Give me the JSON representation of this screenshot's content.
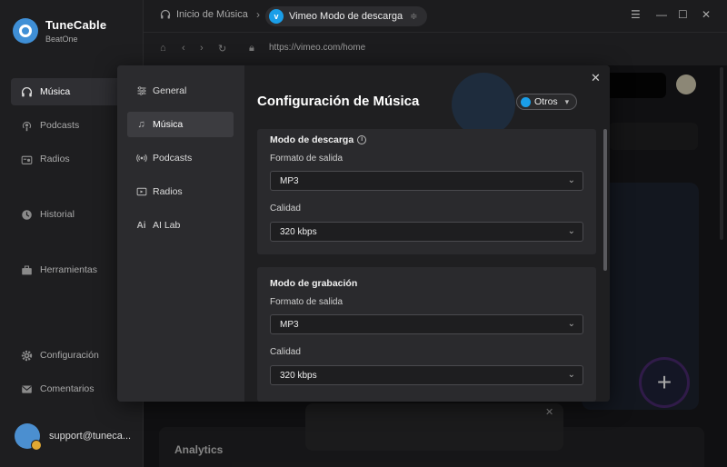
{
  "app": {
    "name": "TuneCable",
    "subtitle": "BeatOne"
  },
  "sidebar": {
    "items": [
      {
        "label": "Música",
        "icon": "headphones-icon",
        "active": true
      },
      {
        "label": "Podcasts",
        "icon": "podcast-icon"
      },
      {
        "label": "Radios",
        "icon": "radio-icon"
      },
      {
        "label": "Historial",
        "icon": "history-icon"
      },
      {
        "label": "Herramientas",
        "icon": "toolbox-icon"
      },
      {
        "label": "Configuración",
        "icon": "gear-icon"
      },
      {
        "label": "Comentarios",
        "icon": "mail-icon"
      }
    ],
    "user_email": "support@tuneca..."
  },
  "topbar": {
    "home_label": "Inicio de Música",
    "tab_label": "Vimeo Modo de descarga",
    "window_controls": [
      "menu",
      "minimize",
      "maximize",
      "close"
    ]
  },
  "browser": {
    "url": "https://vimeo.com/home"
  },
  "background": {
    "analytics_label": "Analytics"
  },
  "settings": {
    "title": "Configuración de Música",
    "source_selector": "Otros",
    "nav": [
      {
        "label": "General",
        "icon": "sliders-icon"
      },
      {
        "label": "Música",
        "icon": "music-note-icon",
        "active": true
      },
      {
        "label": "Podcasts",
        "icon": "podcast-icon"
      },
      {
        "label": "Radios",
        "icon": "radio-icon"
      },
      {
        "label": "AI Lab",
        "icon": "ai-icon"
      }
    ],
    "download_section": {
      "title": "Modo de descarga",
      "format_label": "Formato de salida",
      "format_value": "MP3",
      "quality_label": "Calidad",
      "quality_value": "320 kbps"
    },
    "recording_section": {
      "title": "Modo de grabación",
      "format_label": "Formato de salida",
      "format_value": "MP3",
      "quality_label": "Calidad",
      "quality_value": "320 kbps"
    }
  },
  "colors": {
    "accent": "#1a9ee8",
    "panel": "#252527",
    "background": "#1c1c1e"
  }
}
